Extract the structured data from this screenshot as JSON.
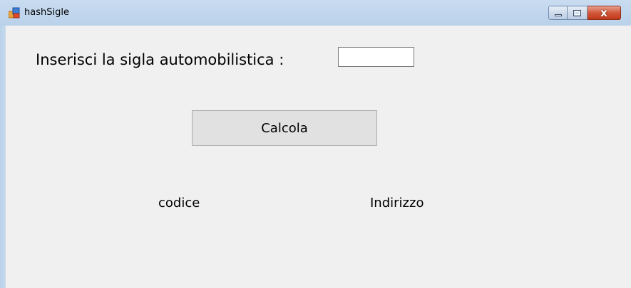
{
  "window": {
    "title": "hashSigle",
    "icon": "app-window-icon",
    "controls": {
      "minimize_icon": "minimize-icon",
      "maximize_icon": "maximize-icon",
      "close_icon": "close-icon",
      "close_glyph": "x"
    }
  },
  "form": {
    "prompt_label": "Inserisci la sigla automobilistica :",
    "sigla_input": {
      "value": "",
      "placeholder": ""
    },
    "calculate_button": "Calcola",
    "codice_label": "codice",
    "indirizzo_label": "Indirizzo"
  },
  "colors": {
    "form_background": "#f0f0f0",
    "titlebar": "#b9d1ea",
    "close_button": "#c7432a"
  }
}
